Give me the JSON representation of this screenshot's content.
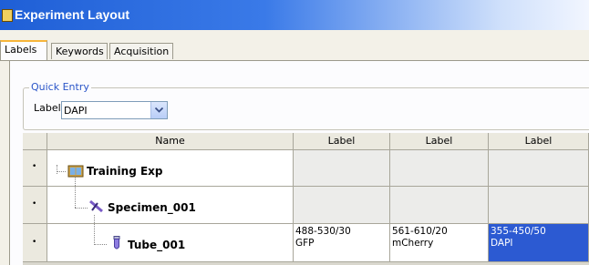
{
  "window": {
    "title": "Experiment Layout"
  },
  "tabs": [
    {
      "label": "Labels",
      "active": true
    },
    {
      "label": "Keywords",
      "active": false
    },
    {
      "label": "Acquisition",
      "active": false
    }
  ],
  "quick_entry": {
    "title": "Quick Entry",
    "label_caption": "Label",
    "label_value": "DAPI"
  },
  "grid": {
    "columns": [
      "Name",
      "Label",
      "Label",
      "Label"
    ],
    "rows": [
      {
        "name": "Training Exp",
        "icon": "book-icon",
        "cells": [
          "",
          "",
          ""
        ]
      },
      {
        "name": "Specimen_001",
        "icon": "specimen-icon",
        "cells": [
          "",
          "",
          ""
        ]
      },
      {
        "name": "Tube_001",
        "icon": "tube-icon",
        "cells": [
          "488-530/30\nGFP",
          "561-610/20\nmCherry",
          "355-450/50\nDAPI"
        ]
      }
    ],
    "row_marker": "•"
  },
  "colors": {
    "title_bar": "#1f5fd6",
    "selection": "#2c5ad2",
    "active_tab": "#f7b53a"
  }
}
